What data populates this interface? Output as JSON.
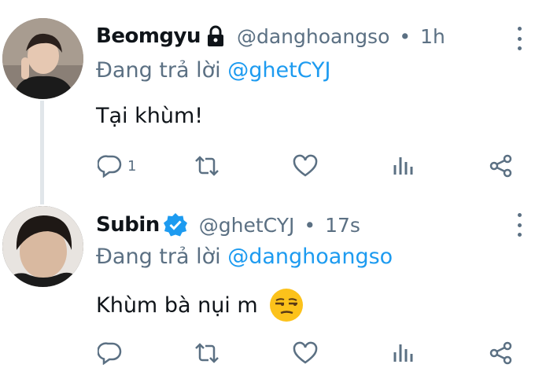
{
  "tweets": [
    {
      "name": "Beomgyu",
      "handle": "@danghoangso",
      "time": "1h",
      "reply_prefix": "Đang trả lời ",
      "reply_to": "@ghetCYJ",
      "text": "Tại khùm!",
      "reply_count": "1",
      "locked": true
    },
    {
      "name": "Subin",
      "handle": "@ghetCYJ",
      "time": "17s",
      "reply_prefix": "Đang trả lời ",
      "reply_to": "@danghoangso",
      "text": "Khùm bà nụi m",
      "emoji": "unamused-face-emoji",
      "verified": true
    }
  ],
  "separator": "•",
  "colors": {
    "accent": "#1d9bf0",
    "secondary_text": "#5b7083",
    "thread_line": "#e1e6ea"
  }
}
